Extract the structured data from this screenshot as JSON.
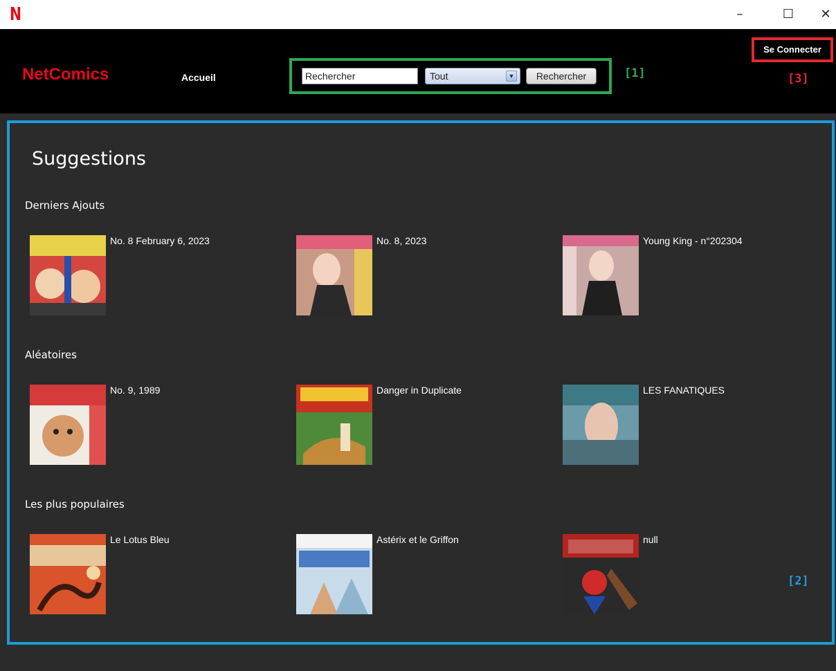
{
  "window": {
    "logo": "N",
    "minimize": "–",
    "maximize": "☐",
    "close": "✕"
  },
  "header": {
    "brand": "NetComics",
    "nav_home": "Accueil",
    "search_value": "Rechercher",
    "filter_selected": "Tout",
    "search_button": "Rechercher",
    "login_button": "Se Connecter"
  },
  "annotations": {
    "a1": "[1]",
    "a2": "[2]",
    "a3": "[3]"
  },
  "main": {
    "title": "Suggestions",
    "categories": [
      {
        "label": "Derniers Ajouts",
        "items": [
          {
            "title": "No. 8 February 6, 2023",
            "cover_color": "#d4473e"
          },
          {
            "title": "No. 8, 2023",
            "cover_color": "#c89a86"
          },
          {
            "title": "Young King - n°202304",
            "cover_color": "#c9a9a5"
          }
        ]
      },
      {
        "label": "Aléatoires",
        "items": [
          {
            "title": "No. 9, 1989",
            "cover_color": "#d63b3b"
          },
          {
            "title": "Danger in Duplicate",
            "cover_color": "#4f8a3a"
          },
          {
            "title": "LES FANATIQUES",
            "cover_color": "#6b9aa8"
          }
        ]
      },
      {
        "label": "Les plus populaires",
        "items": [
          {
            "title": "Le Lotus Bleu",
            "cover_color": "#d9532b"
          },
          {
            "title": "Astérix et le Griffon",
            "cover_color": "#c8dbea"
          },
          {
            "title": "null",
            "cover_color": "#b3241f"
          }
        ]
      }
    ]
  }
}
